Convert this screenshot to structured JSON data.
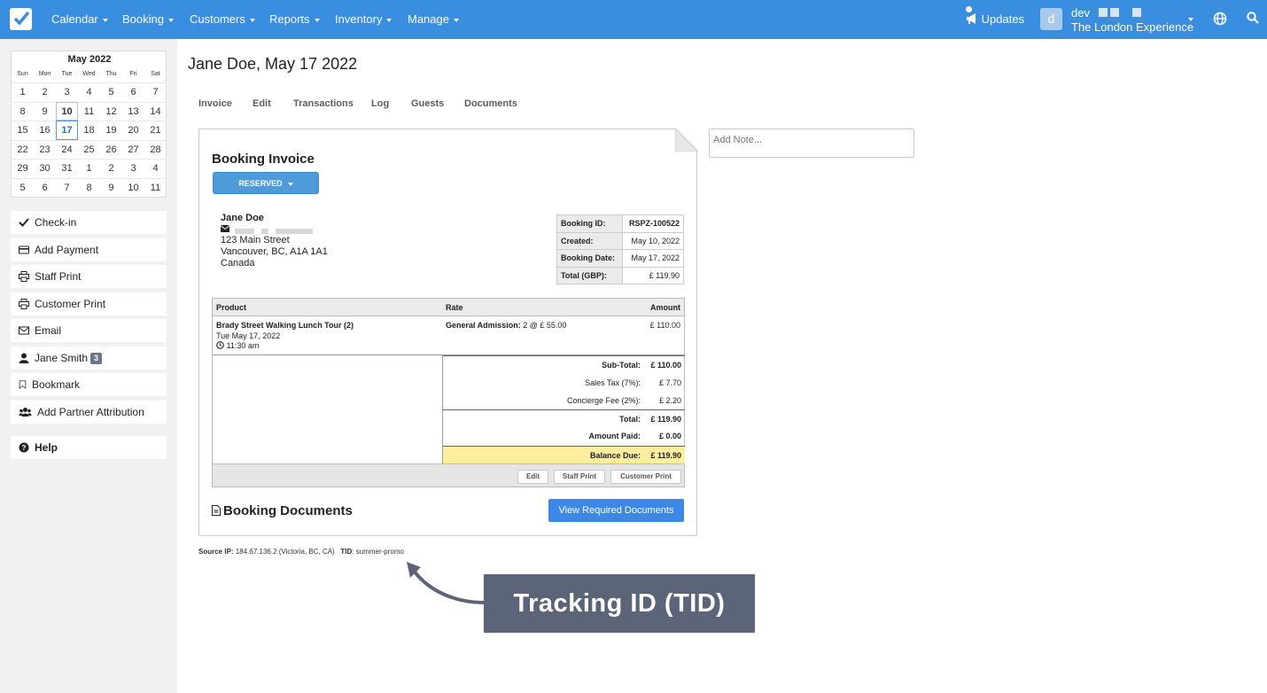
{
  "nav": {
    "items": [
      "Calendar",
      "Booking",
      "Customers",
      "Reports",
      "Inventory",
      "Manage"
    ],
    "updates": "Updates",
    "avatar_letter": "d",
    "user": "dev",
    "company": "The London Experience",
    "accent_color": "#3a8ee0"
  },
  "calendar": {
    "title": "May 2022",
    "dows": [
      "Sun",
      "Mon",
      "Tue",
      "Wed",
      "Thu",
      "Fri",
      "Sat"
    ],
    "days": [
      "1",
      "2",
      "3",
      "4",
      "5",
      "6",
      "7",
      "8",
      "9",
      "10",
      "11",
      "12",
      "13",
      "14",
      "15",
      "16",
      "17",
      "18",
      "19",
      "20",
      "21",
      "22",
      "23",
      "24",
      "25",
      "26",
      "27",
      "28",
      "29",
      "30",
      "31",
      "1",
      "2",
      "3",
      "4",
      "5",
      "6",
      "7",
      "8",
      "9",
      "10",
      "11"
    ],
    "today": "10",
    "selected": "17"
  },
  "sidebar": {
    "buttons": [
      {
        "label": "Check-in",
        "icon": "check-icon"
      },
      {
        "label": "Add Payment",
        "icon": "credit-card-icon"
      },
      {
        "label": "Staff Print",
        "icon": "printer-icon"
      },
      {
        "label": "Customer Print",
        "icon": "printer-icon"
      },
      {
        "label": "Email",
        "icon": "envelope-icon"
      },
      {
        "label": "Jane Smith",
        "icon": "user-icon",
        "badge": "3"
      },
      {
        "label": "Bookmark",
        "icon": "bookmark-icon"
      },
      {
        "label": "Add Partner Attribution",
        "icon": "users-icon"
      }
    ],
    "help": "Help"
  },
  "page": {
    "title": "Jane Doe, May 17 2022",
    "tabs": [
      "Invoice",
      "Edit",
      "Transactions",
      "Log",
      "Guests",
      "Documents"
    ]
  },
  "invoice": {
    "title": "Booking Invoice",
    "status": "RESERVED",
    "customer": {
      "name": "Jane Doe",
      "address": [
        "123 Main Street",
        "Vancouver, BC, A1A 1A1",
        "Canada"
      ]
    },
    "info": [
      {
        "k": "Booking ID:",
        "v": "RSPZ-100522"
      },
      {
        "k": "Created:",
        "v": "May 10, 2022"
      },
      {
        "k": "Booking Date:",
        "v": "May 17, 2022"
      },
      {
        "k": "Total (GBP):",
        "v": "£ 119.90"
      }
    ],
    "headers": {
      "product": "Product",
      "rate": "Rate",
      "amount": "Amount"
    },
    "line": {
      "product": "Brady Street Walking Lunch Tour (2)",
      "date": "Tue May 17, 2022",
      "time": "11:30 am",
      "rate_label": "General Admission:",
      "rate_value": "2 @ £ 55.00",
      "amount": "£ 110.00"
    },
    "totals": [
      {
        "k": "Sub-Total:",
        "v": "£ 110.00"
      },
      {
        "k": "Sales Tax (7%):",
        "v": "£ 7.70"
      },
      {
        "k": "Concierge Fee (2%):",
        "v": "£ 2.20"
      },
      {
        "k": "Total:",
        "v": "£ 119.90"
      },
      {
        "k": "Amount Paid:",
        "v": "£ 0.00"
      },
      {
        "k": "Balance Due:",
        "v": "£ 119.90"
      }
    ],
    "footer_buttons": [
      "Edit",
      "Staff Print",
      "Customer Print"
    ],
    "documents_title": "Booking Documents",
    "documents_button": "View Required Documents"
  },
  "note_placeholder": "Add Note...",
  "meta": {
    "source_ip_label": "Source IP:",
    "source_ip": "184.67.136.2 (Victoria, BC, CA)",
    "tid_label": "TID",
    "tid": ": summer-promo"
  },
  "callout": "Tracking ID (TID)"
}
